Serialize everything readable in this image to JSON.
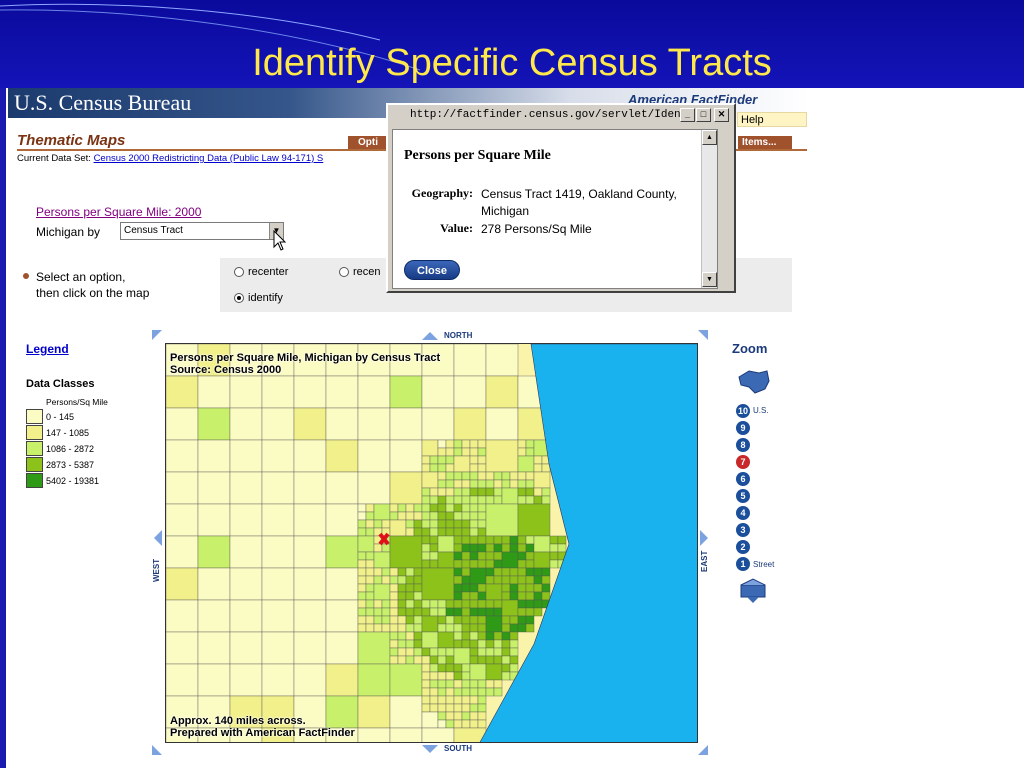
{
  "slide": {
    "title": "Identify Specific Census Tracts"
  },
  "header": {
    "logo": "U.S. Census Bureau",
    "aff_logo": "American FactFinder",
    "help": "Help"
  },
  "thematic": {
    "title": "Thematic Maps",
    "options_tab": "Opti",
    "items_tab": "Items...",
    "current_dataset_label": "Current Data Set:",
    "current_dataset_link": "Census 2000 Redistricting Data (Public Law 94-171) S"
  },
  "theme": {
    "theme_link": "Persons per Square Mile: 2000",
    "geo_label": "Michigan by",
    "geo_select": "Census Tract"
  },
  "instructions": {
    "line1": "Select an option,",
    "line2": "then click on the map"
  },
  "map_options": [
    {
      "label": "recenter",
      "checked": false
    },
    {
      "label": "recen",
      "checked": false
    },
    {
      "label": "identify",
      "checked": true
    }
  ],
  "legend": {
    "link": "Legend",
    "title": "Data Classes",
    "unit": "Persons/Sq Mile",
    "classes": [
      {
        "label": "0 - 145",
        "color": "#fbfbc4"
      },
      {
        "label": "147 - 1085",
        "color": "#f2f08a"
      },
      {
        "label": "1086 - 2872",
        "color": "#c8f06a"
      },
      {
        "label": "2873 - 5387",
        "color": "#8cc21a"
      },
      {
        "label": "5402 - 19381",
        "color": "#2e9a16"
      }
    ]
  },
  "map": {
    "title_line1": "Persons per Square Mile, Michigan by Census Tract",
    "title_line2": "Source: Census 2000",
    "footer_line1": "Approx. 140 miles across.",
    "footer_line2": "Prepared with American FactFinder",
    "north": "NORTH",
    "south": "SOUTH",
    "east": "EAST",
    "west": "WEST",
    "water_color": "#1ab2ee",
    "land_color": "#f9f4aa"
  },
  "zoom": {
    "label": "Zoom",
    "levels": [
      "10",
      "9",
      "8",
      "7",
      "6",
      "5",
      "4",
      "3",
      "2",
      "1"
    ],
    "current_level": "7",
    "top_caption": "U.S.",
    "bottom_caption": "Street"
  },
  "popup": {
    "window_title": "http://factfinder.census.gov/servlet/Iden...",
    "heading": "Persons per Square Mile",
    "geography_label": "Geography:",
    "geography_value": "Census Tract 1419, Oakland County, Michigan",
    "value_label": "Value:",
    "value_value": "278 Persons/Sq Mile",
    "close_button": "Close"
  }
}
